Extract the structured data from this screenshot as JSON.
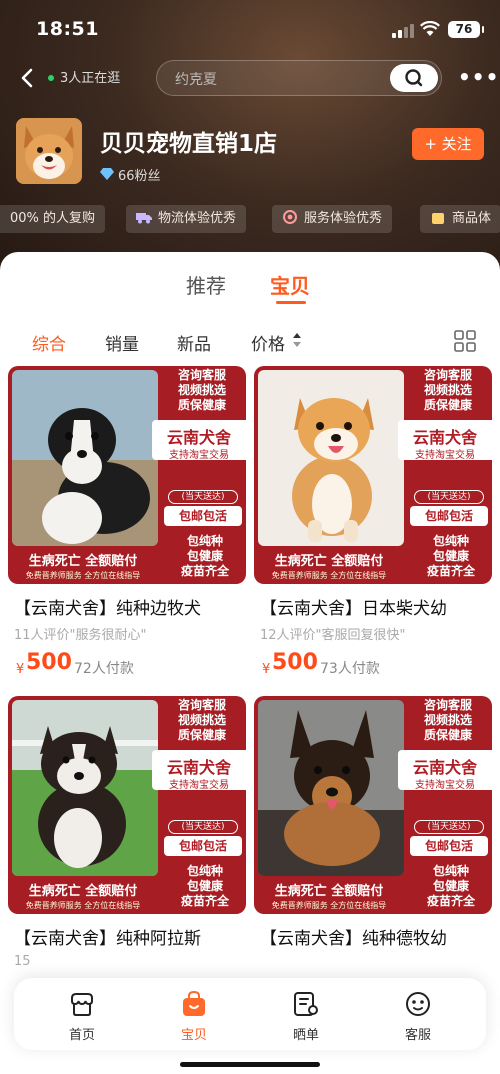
{
  "status_bar": {
    "time": "18:51",
    "battery": "76"
  },
  "header": {
    "online_text": "3人正在逛",
    "search_placeholder": "约克夏"
  },
  "shop": {
    "name": "贝贝宠物直销1店",
    "fans": "66粉丝",
    "follow_label": "+ 关注",
    "badges": [
      "00% 的人复购",
      "物流体验优秀",
      "服务体验优秀",
      "商品体"
    ]
  },
  "tabs": [
    {
      "label": "推荐",
      "active": false
    },
    {
      "label": "宝贝",
      "active": true
    }
  ],
  "sort": {
    "items": [
      "综合",
      "销量",
      "新品",
      "价格"
    ],
    "active": "综合"
  },
  "promo": {
    "top": "咨询客服\n视频挑选\n质保健康",
    "brand": "云南犬舍",
    "sub": "支持淘宝交易",
    "pill1": "(当天送达)",
    "pill2": "包邮包活",
    "bottom": "包纯种\n包健康\n疫苗齐全",
    "banner": "生病死亡  全额赔付",
    "banner_sub": "免费晋养师服务  全方位在线指导"
  },
  "products": [
    {
      "title": "【云南犬舍】纯种边牧犬",
      "review": "11人评价\"服务很耐心\"",
      "price_symbol": "¥",
      "price": "500",
      "sales": "72人付款",
      "photo": "border-collie-puppy"
    },
    {
      "title": "【云南犬舍】日本柴犬幼",
      "review": "12人评价\"客服回复很快\"",
      "price_symbol": "¥",
      "price": "500",
      "sales": "73人付款",
      "photo": "shiba-inu-puppy"
    },
    {
      "title": "【云南犬舍】纯种阿拉斯",
      "review": "15",
      "price_symbol": "",
      "price": "",
      "sales": "",
      "photo": "alaskan-malamute-puppy"
    },
    {
      "title": "【云南犬舍】纯种德牧幼",
      "review": "",
      "price_symbol": "",
      "price": "",
      "sales": "",
      "photo": "german-shepherd-puppy"
    }
  ],
  "bottom_nav": [
    {
      "label": "首页",
      "icon": "shop-icon",
      "active": false
    },
    {
      "label": "宝贝",
      "icon": "bag-icon",
      "active": true
    },
    {
      "label": "晒单",
      "icon": "review-icon",
      "active": false
    },
    {
      "label": "客服",
      "icon": "service-icon",
      "active": false
    }
  ],
  "colors": {
    "accent": "#ff5a1f",
    "promo_red": "#a61e24",
    "price": "#ff4a1a"
  }
}
